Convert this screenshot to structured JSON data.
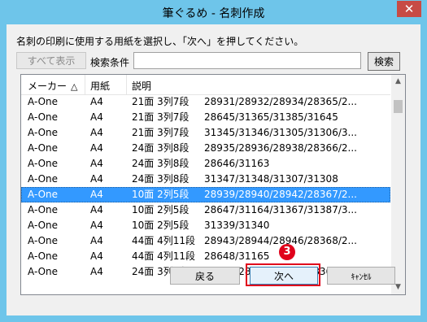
{
  "window": {
    "title": "筆ぐるめ - 名刺作成",
    "close_glyph": "✕"
  },
  "instruction": "名刺の印刷に使用する用紙を選択し、「次へ」を押してください。",
  "toolbar": {
    "show_all_label": "すべて表示",
    "search_label": "検索条件",
    "search_value": "",
    "search_button_label": "検索"
  },
  "list": {
    "columns": [
      "メーカー",
      "用紙",
      "説明"
    ],
    "sort_icon": "△",
    "rows": [
      {
        "maker": "A-One",
        "size": "A4",
        "layout": "21面  3列7段",
        "numbers": "28931/28932/28934/28365/2..."
      },
      {
        "maker": "A-One",
        "size": "A4",
        "layout": "21面  3列7段",
        "numbers": "28645/31365/31385/31645"
      },
      {
        "maker": "A-One",
        "size": "A4",
        "layout": "21面  3列7段",
        "numbers": "31345/31346/31305/31306/3..."
      },
      {
        "maker": "A-One",
        "size": "A4",
        "layout": "24面  3列8段",
        "numbers": "28935/28936/28938/28366/2..."
      },
      {
        "maker": "A-One",
        "size": "A4",
        "layout": "24面  3列8段",
        "numbers": "28646/31163"
      },
      {
        "maker": "A-One",
        "size": "A4",
        "layout": "24面  3列8段",
        "numbers": "31347/31348/31307/31308"
      },
      {
        "maker": "A-One",
        "size": "A4",
        "layout": "10面  2列5段",
        "numbers": "28939/28940/28942/28367/2..."
      },
      {
        "maker": "A-One",
        "size": "A4",
        "layout": "10面  2列5段",
        "numbers": "28647/31164/31367/31387/3..."
      },
      {
        "maker": "A-One",
        "size": "A4",
        "layout": "10面  2列5段",
        "numbers": "31339/31340"
      },
      {
        "maker": "A-One",
        "size": "A4",
        "layout": "44面  4列11段",
        "numbers": "28943/28944/28946/28368/2..."
      },
      {
        "maker": "A-One",
        "size": "A4",
        "layout": "44面  4列11段",
        "numbers": "28648/31165"
      },
      {
        "maker": "A-One",
        "size": "A4",
        "layout": "24面  3列8段",
        "numbers": "28947/28948/28950/28369/2..."
      }
    ],
    "selected_index": 6
  },
  "buttons": {
    "back_label": "戻る",
    "next_label": "次へ",
    "cancel_label": "ｷｬﾝｾﾙ"
  },
  "callout": {
    "number": "3",
    "color": "#e0001b"
  }
}
